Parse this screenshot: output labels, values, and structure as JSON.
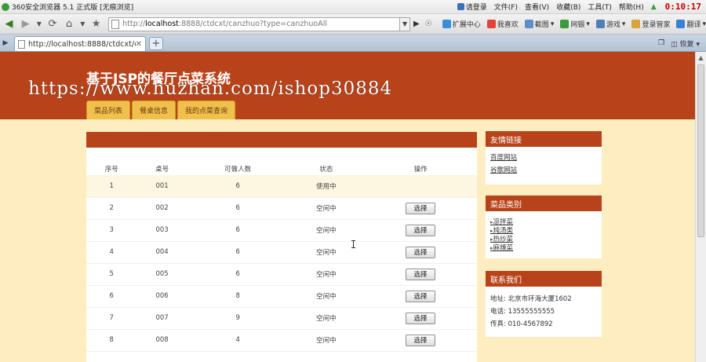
{
  "browser": {
    "title": "360安全浏览器 5.1 正式版 [无痕浏览]",
    "menu": [
      "请登录",
      "文件(F)",
      "查看(V)",
      "收藏(B)",
      "工具(T)",
      "帮助(H)"
    ],
    "clock": "0:10:17",
    "url_prefix": "http://",
    "url_host": "localhost",
    "url_rest": ":8888/ctdcxt/canzhuo?type=canzhuoAll",
    "toolbar": [
      "扩展中心",
      "我喜欢",
      "截图",
      "网银",
      "游戏",
      "登录管家",
      "翻译"
    ],
    "tab_title": "http://localhost:8888/ctdcxt/can...",
    "tab_right": "恢复"
  },
  "site": {
    "title": "基于JSP的餐厅点菜系统",
    "watermark": "https://www.huzhan.com/ishop30884",
    "nav": [
      "菜品列表",
      "餐桌信息",
      "我的点菜查询"
    ]
  },
  "table": {
    "headers": [
      "序号",
      "桌号",
      "可做人数",
      "状态",
      "操作"
    ],
    "select_label": "选择",
    "rows": [
      {
        "idx": "1",
        "num": "001",
        "cap": "6",
        "status": "使用中",
        "action": ""
      },
      {
        "idx": "2",
        "num": "002",
        "cap": "6",
        "status": "空闲中",
        "action": "选择"
      },
      {
        "idx": "3",
        "num": "003",
        "cap": "6",
        "status": "空闲中",
        "action": "选择"
      },
      {
        "idx": "4",
        "num": "004",
        "cap": "6",
        "status": "空闲中",
        "action": "选择"
      },
      {
        "idx": "5",
        "num": "005",
        "cap": "6",
        "status": "空闲中",
        "action": "选择"
      },
      {
        "idx": "6",
        "num": "006",
        "cap": "8",
        "status": "空闲中",
        "action": "选择"
      },
      {
        "idx": "7",
        "num": "007",
        "cap": "9",
        "status": "空闲中",
        "action": "选择"
      },
      {
        "idx": "8",
        "num": "008",
        "cap": "4",
        "status": "空闲中",
        "action": "选择"
      }
    ]
  },
  "sidebar": {
    "links": {
      "title": "友情链接",
      "items": [
        "百度网站",
        "谷歌网站"
      ]
    },
    "categories": {
      "title": "菜品类别",
      "items": [
        "凉拌菜",
        "炖汤类",
        "热炒菜",
        "麻辣菜"
      ]
    },
    "contact": {
      "title": "联系我们",
      "address": "地址: 北京市环海大厦1602",
      "phone": "电话: 13555555555",
      "fax": "传真: 010-4567892"
    }
  },
  "colors": {
    "brand": "#b8431a",
    "page_bg": "#fdedc1",
    "nav_tab": "#f0c04c"
  }
}
